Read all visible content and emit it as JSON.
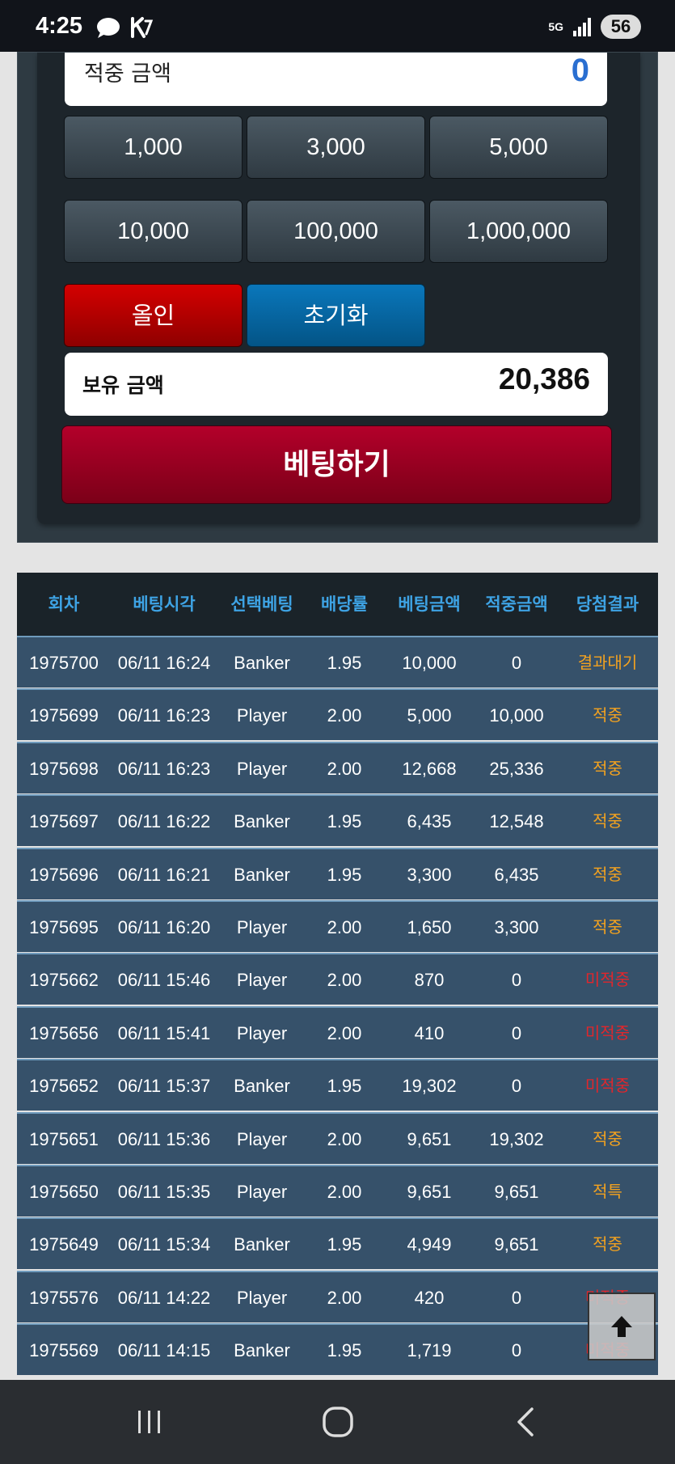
{
  "status_bar": {
    "time": "4:25",
    "network": "5G",
    "battery": "56",
    "icons": [
      "chat-bubble-icon",
      "k-app-icon",
      "signal-icon"
    ]
  },
  "bet_panel": {
    "hit_amount_label": "적중 금액",
    "hit_amount_value": "0",
    "amount_buttons": [
      "1,000",
      "3,000",
      "5,000",
      "10,000",
      "100,000",
      "1,000,000"
    ],
    "allin_label": "올인",
    "reset_label": "초기화",
    "balance_label": "보유 금액",
    "balance_value": "20,386",
    "bet_button_label": "베팅하기"
  },
  "history": {
    "headers": [
      "회차",
      "베팅시각",
      "선택베팅",
      "배당률",
      "베팅금액",
      "적중금액",
      "당첨결과"
    ],
    "rows": [
      {
        "round": "1975700",
        "time": "06/11 16:24",
        "pick": "Banker",
        "odds": "1.95",
        "bet": "10,000",
        "win": "0",
        "result": "결과대기",
        "status": "pending"
      },
      {
        "round": "1975699",
        "time": "06/11 16:23",
        "pick": "Player",
        "odds": "2.00",
        "bet": "5,000",
        "win": "10,000",
        "result": "적중",
        "status": "win"
      },
      {
        "round": "1975698",
        "time": "06/11 16:23",
        "pick": "Player",
        "odds": "2.00",
        "bet": "12,668",
        "win": "25,336",
        "result": "적중",
        "status": "win"
      },
      {
        "round": "1975697",
        "time": "06/11 16:22",
        "pick": "Banker",
        "odds": "1.95",
        "bet": "6,435",
        "win": "12,548",
        "result": "적중",
        "status": "win"
      },
      {
        "round": "1975696",
        "time": "06/11 16:21",
        "pick": "Banker",
        "odds": "1.95",
        "bet": "3,300",
        "win": "6,435",
        "result": "적중",
        "status": "win"
      },
      {
        "round": "1975695",
        "time": "06/11 16:20",
        "pick": "Player",
        "odds": "2.00",
        "bet": "1,650",
        "win": "3,300",
        "result": "적중",
        "status": "win"
      },
      {
        "round": "1975662",
        "time": "06/11 15:46",
        "pick": "Player",
        "odds": "2.00",
        "bet": "870",
        "win": "0",
        "result": "미적중",
        "status": "lose"
      },
      {
        "round": "1975656",
        "time": "06/11 15:41",
        "pick": "Player",
        "odds": "2.00",
        "bet": "410",
        "win": "0",
        "result": "미적중",
        "status": "lose"
      },
      {
        "round": "1975652",
        "time": "06/11 15:37",
        "pick": "Banker",
        "odds": "1.95",
        "bet": "19,302",
        "win": "0",
        "result": "미적중",
        "status": "lose"
      },
      {
        "round": "1975651",
        "time": "06/11 15:36",
        "pick": "Player",
        "odds": "2.00",
        "bet": "9,651",
        "win": "19,302",
        "result": "적중",
        "status": "win"
      },
      {
        "round": "1975650",
        "time": "06/11 15:35",
        "pick": "Player",
        "odds": "2.00",
        "bet": "9,651",
        "win": "9,651",
        "result": "적특",
        "status": "win"
      },
      {
        "round": "1975649",
        "time": "06/11 15:34",
        "pick": "Banker",
        "odds": "1.95",
        "bet": "4,949",
        "win": "9,651",
        "result": "적중",
        "status": "win"
      },
      {
        "round": "1975576",
        "time": "06/11 14:22",
        "pick": "Player",
        "odds": "2.00",
        "bet": "420",
        "win": "0",
        "result": "미적중",
        "status": "lose"
      },
      {
        "round": "1975569",
        "time": "06/11 14:15",
        "pick": "Banker",
        "odds": "1.95",
        "bet": "1,719",
        "win": "0",
        "result": "미적중",
        "status": "lose"
      }
    ]
  },
  "colors": {
    "header_text": "#3ea3e4",
    "row_bg": "#36516a",
    "pending": "#f3a21f",
    "win": "#f3a21f",
    "lose": "#e0262c",
    "allin": "#c80000",
    "reset": "#0a6fb0",
    "bet": "#a3001f"
  },
  "scroll_top_icon": "arrow-up-icon",
  "nav_icons": [
    "recent-apps-icon",
    "home-icon",
    "back-icon"
  ]
}
